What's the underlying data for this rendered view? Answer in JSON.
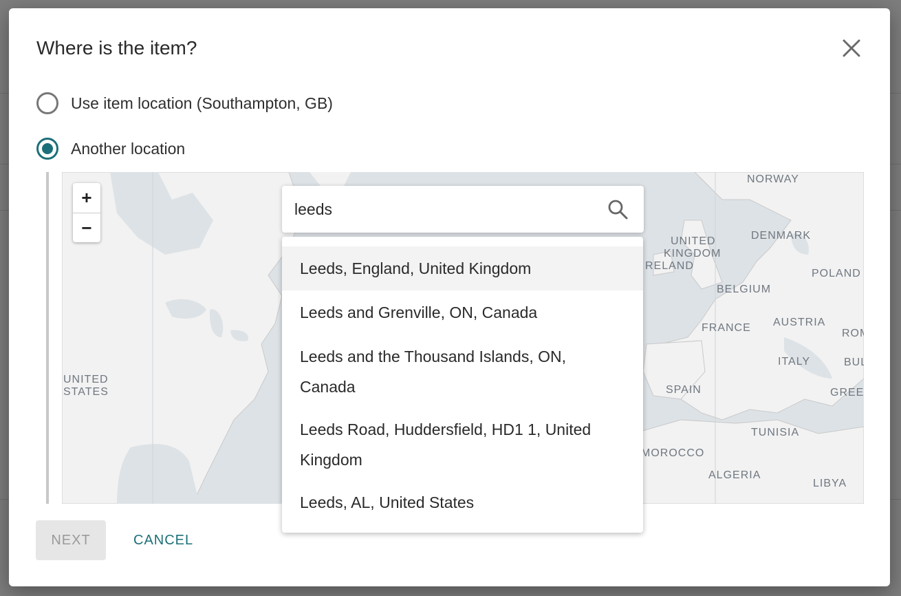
{
  "dialog": {
    "title": "Where is the item?",
    "close_icon": "close-icon"
  },
  "options": [
    {
      "label": "Use item location (Southampton, GB)",
      "checked": false
    },
    {
      "label": "Another location",
      "checked": true
    }
  ],
  "map": {
    "zoom_in_label": "+",
    "zoom_out_label": "−",
    "labels": [
      "NORWAY",
      "DENMARK",
      "UNITED",
      "KINGDOM",
      "RELAND",
      "POLAND",
      "BELGIUM",
      "FRANCE",
      "AUSTRIA",
      "ROM",
      "ITALY",
      "BUL",
      "SPAIN",
      "GREEC",
      "TUNISIA",
      "MOROCCO",
      "ALGERIA",
      "LIBYA",
      "UNITED",
      "STATES"
    ]
  },
  "search": {
    "value": "leeds",
    "icon": "search-icon"
  },
  "suggestions": [
    "Leeds, England, United Kingdom",
    "Leeds and Grenville, ON, Canada",
    "Leeds and the Thousand Islands, ON, Canada",
    "Leeds Road, Huddersfield, HD1 1, United Kingdom",
    "Leeds, AL, United States"
  ],
  "actions": {
    "next_label": "NEXT",
    "cancel_label": "CANCEL"
  },
  "colors": {
    "accent": "#1b6f78",
    "land": "#f2f2f2",
    "water": "#dde2e6"
  }
}
